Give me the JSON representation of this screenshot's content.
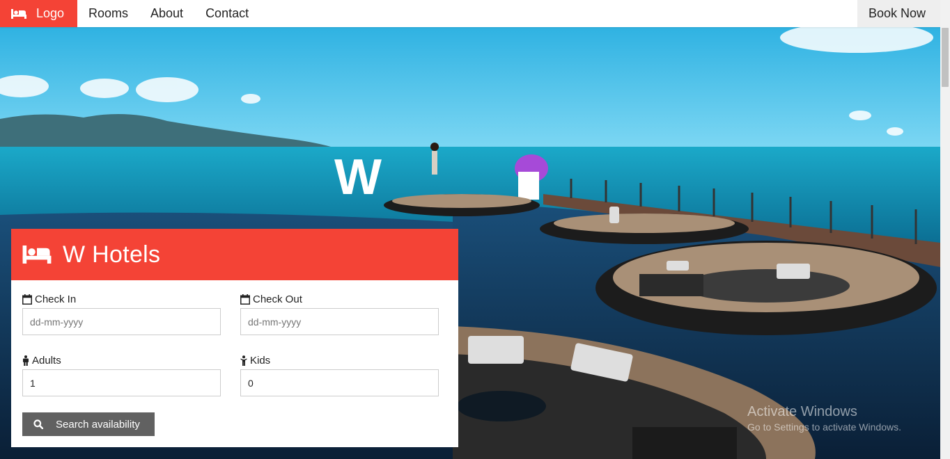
{
  "nav": {
    "logo_label": "Logo",
    "logo_icon": "bed-icon",
    "links": [
      "Rooms",
      "About",
      "Contact"
    ],
    "book_label": "Book Now"
  },
  "hero": {
    "sign_letter": "W"
  },
  "booking": {
    "title": "W Hotels",
    "title_icon": "bed-icon",
    "check_in": {
      "label": "Check In",
      "placeholder": "dd-mm-yyyy",
      "icon": "calendar-icon"
    },
    "check_out": {
      "label": "Check Out",
      "placeholder": "dd-mm-yyyy",
      "icon": "calendar-icon"
    },
    "adults": {
      "label": "Adults",
      "value": "1",
      "icon": "adult-icon"
    },
    "kids": {
      "label": "Kids",
      "value": "0",
      "icon": "child-icon"
    },
    "search_label": "Search availability",
    "search_icon": "search-icon"
  },
  "watermark": {
    "title": "Activate Windows",
    "subtitle": "Go to Settings to activate Windows."
  },
  "colors": {
    "accent": "#f44336",
    "button": "#616161",
    "book_bg": "#eeeeee"
  }
}
